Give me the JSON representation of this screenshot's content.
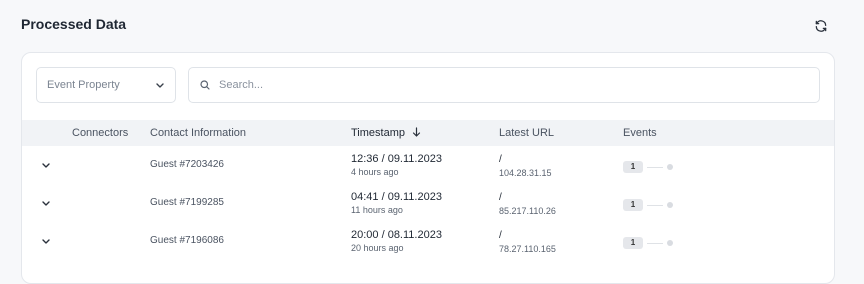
{
  "header": {
    "title": "Processed Data"
  },
  "filters": {
    "property_label": "Event Property",
    "search_placeholder": "Search...",
    "search_value": ""
  },
  "table": {
    "columns": {
      "connectors": "Connectors",
      "contact": "Contact Information",
      "timestamp": "Timestamp",
      "url": "Latest URL",
      "events": "Events"
    },
    "rows": [
      {
        "contact": "Guest #7203426",
        "time": "12:36 / 09.11.2023",
        "relative": "4 hours ago",
        "url": "/",
        "ip": "104.28.31.15",
        "events_count": "1"
      },
      {
        "contact": "Guest #7199285",
        "time": "04:41 / 09.11.2023",
        "relative": "11 hours ago",
        "url": "/",
        "ip": "85.217.110.26",
        "events_count": "1"
      },
      {
        "contact": "Guest #7196086",
        "time": "20:00 / 08.11.2023",
        "relative": "20 hours ago",
        "url": "/",
        "ip": "78.27.110.165",
        "events_count": "1"
      }
    ]
  },
  "icons": {
    "refresh": "refresh-icon",
    "search": "search-icon",
    "dropdown": "chevron-down-icon",
    "sort": "arrow-down-icon",
    "expand": "chevron-down-icon"
  }
}
